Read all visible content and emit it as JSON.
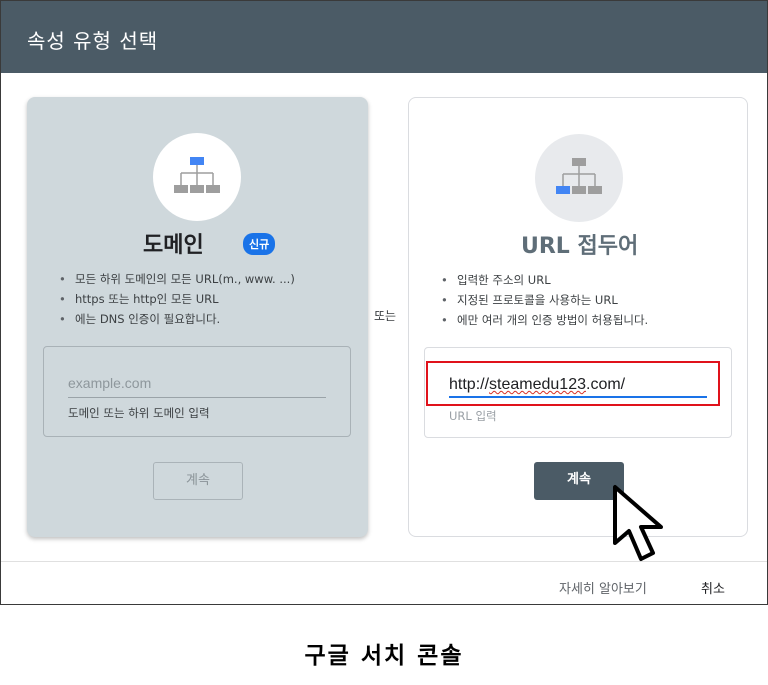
{
  "dialog": {
    "title": "속성 유형 선택",
    "or_label": "또는",
    "footer": {
      "learn_more": "자세히 알아보기",
      "cancel": "취소"
    }
  },
  "domain_card": {
    "title": "도메인",
    "badge": "신규",
    "icon": "sitemap-icon",
    "bullets": [
      "모든 하위 도메인의 모든 URL(m., www. ...)",
      "https 또는 http인 모든 URL",
      "에는 DNS 인증이 필요합니다."
    ],
    "input_placeholder": "example.com",
    "input_helper": "도메인 또는 하위 도메인 입력",
    "continue_label": "계속"
  },
  "url_card": {
    "title": "URL 접두어",
    "icon": "sitemap-icon",
    "bullets": [
      "입력한 주소의 URL",
      "지정된 프로토콜을 사용하는 URL",
      "에만 여러 개의 인증 방법이 허용됩니다."
    ],
    "input_value_prefix": "http://",
    "input_value_underlined": "steamedu123",
    "input_value_suffix": ".com/",
    "input_helper": "URL 입력",
    "continue_label": "계속"
  },
  "caption": "구글 서치 콘솔",
  "colors": {
    "header": "#4b5b66",
    "accent": "#1a73e8",
    "highlight": "#e0121b",
    "domain_card_bg": "#cfd8dc"
  }
}
